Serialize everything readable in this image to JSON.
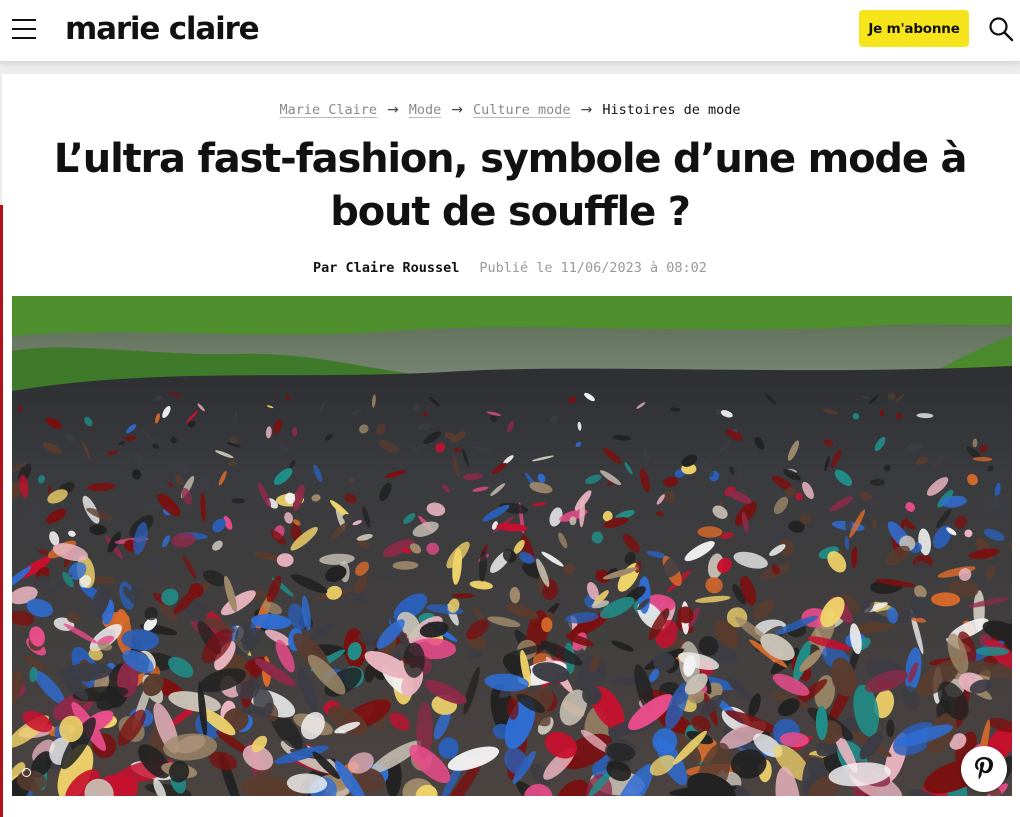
{
  "header": {
    "menu_icon": "hamburger-menu-icon",
    "logo_text": "marie claire",
    "subscribe_label": "Je m'abonne",
    "search_icon": "search-icon",
    "accent_color": "#f7e51b"
  },
  "breadcrumb": {
    "items": [
      "Marie Claire",
      "Mode",
      "Culture mode"
    ],
    "current": "Histoires de mode",
    "separator_icon": "arrow-right-icon"
  },
  "article": {
    "title": "L’ultra fast-fashion, symbole d’une mode à bout de souffle ?",
    "author": "Par Claire Roussel",
    "published": "Publié le 11/06/2023 à 08:02"
  },
  "hero": {
    "image_icon": "photo-textile-waste",
    "pin_icon": "pinterest-icon"
  }
}
